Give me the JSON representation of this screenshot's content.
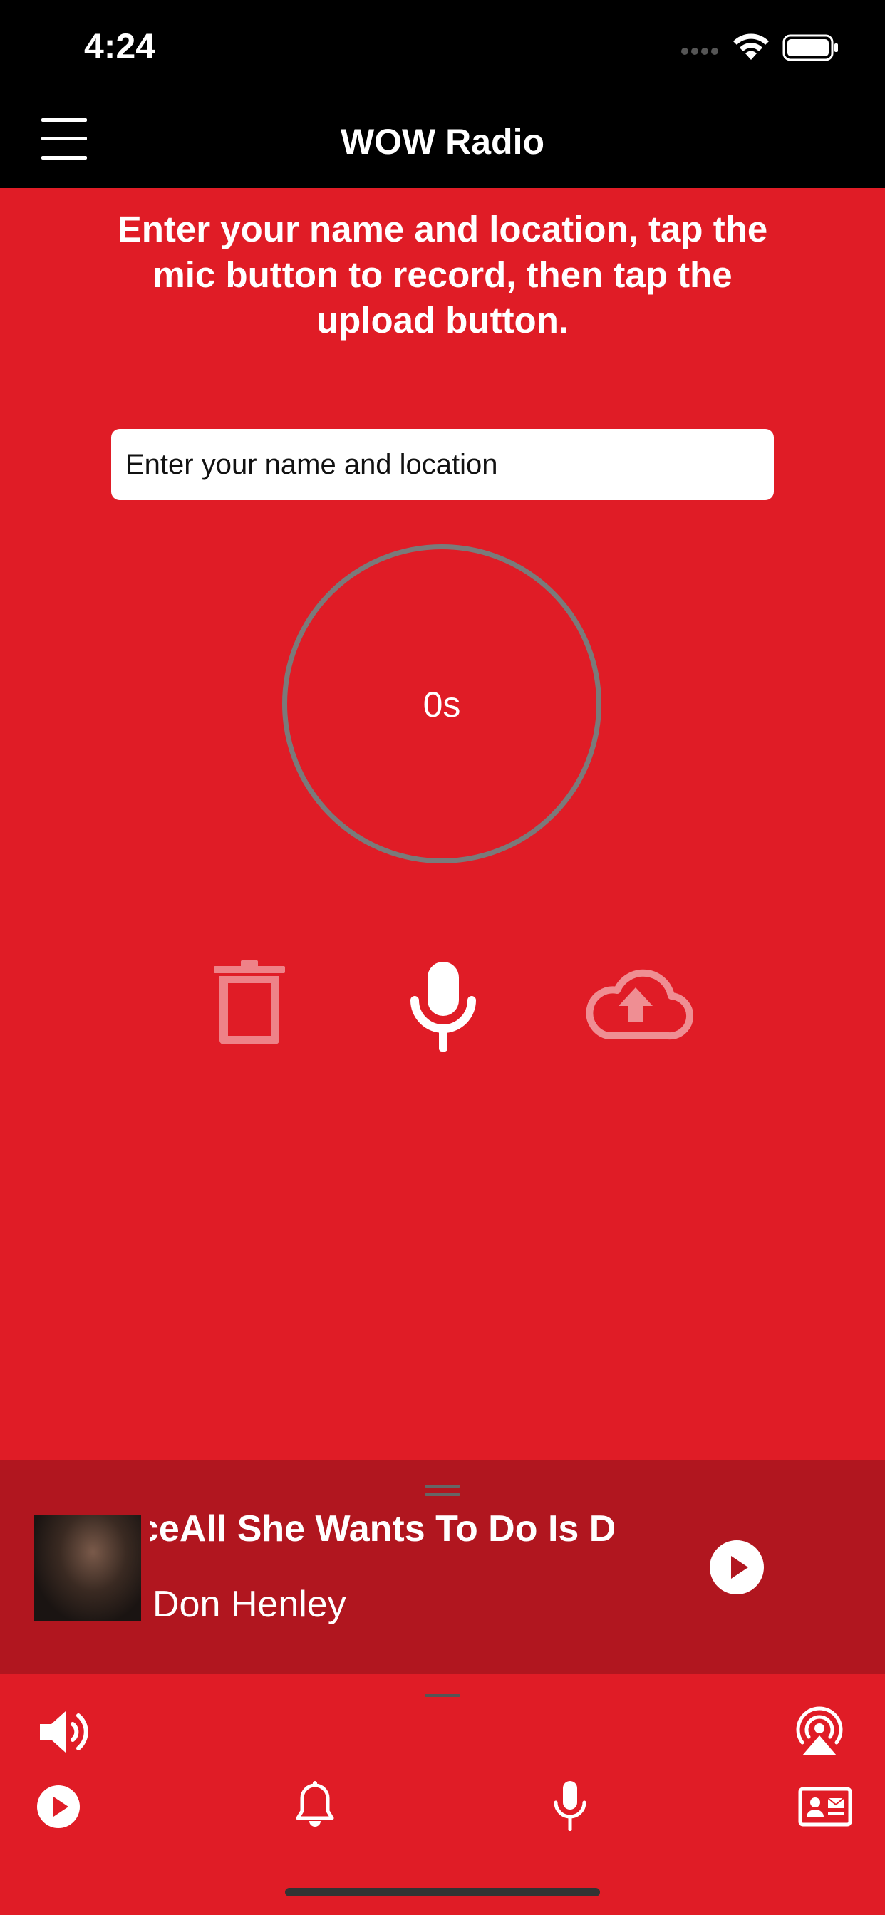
{
  "status_bar": {
    "time": "4:24"
  },
  "nav": {
    "title": "WOW Radio",
    "menu_icon": "hamburger-menu-icon"
  },
  "instructions": "Enter your name and location, tap the mic button to record, then tap the upload button.",
  "name_input": {
    "placeholder": "Enter your name and location",
    "value": ""
  },
  "timer": {
    "text": "0s"
  },
  "controls": {
    "delete_icon": "trash-icon",
    "record_icon": "microphone-icon",
    "upload_icon": "cloud-upload-icon"
  },
  "now_playing": {
    "title": "ceAll She Wants To Do Is D",
    "artist": "Don Henley",
    "play_icon": "play-circle-icon"
  },
  "bottom_bar": {
    "volume_icon": "speaker-volume-icon",
    "airplay_icon": "airplay-icon",
    "tabs": [
      "play-icon",
      "bell-icon",
      "microphone-icon",
      "contact-card-icon"
    ]
  },
  "colors": {
    "background": "#E01C26",
    "mini_player": "#B1161F",
    "nav": "#000000",
    "ring": "#7A7A7A"
  }
}
